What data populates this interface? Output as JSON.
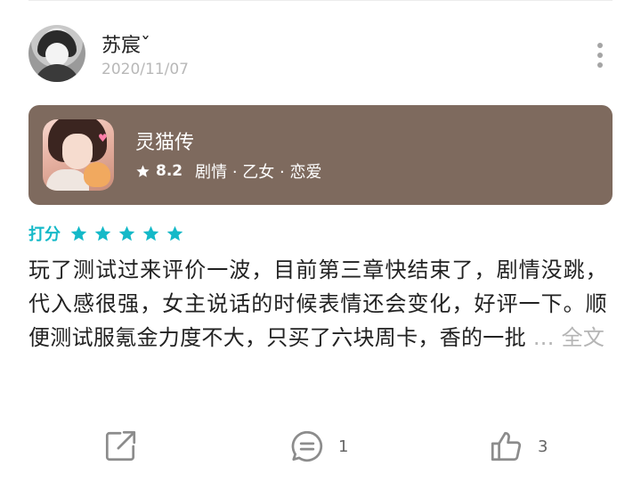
{
  "review": {
    "author": {
      "name": "苏宸ˇ",
      "date": "2020/11/07"
    },
    "game": {
      "title": "灵猫传",
      "rating": "8.2",
      "tags": "剧情 · 乙女 · 恋爱"
    },
    "score": {
      "label": "打分",
      "stars": 5,
      "max_stars": 5,
      "star_color": "#14b9c8"
    },
    "body": {
      "text": "玩了测试过来评价一波，目前第三章快结束了，剧情没跳，代入感很强，女主说话的时候表情还会变化，好评一下。顺便测试服氪金力度不大，只买了六块周卡，香的一批",
      "ellipsis": "...",
      "more_label": "全文"
    },
    "actions": {
      "share": {
        "icon": "share-icon"
      },
      "comment": {
        "icon": "comment-icon",
        "count": "1"
      },
      "like": {
        "icon": "thumbs-up-icon",
        "count": "3"
      }
    },
    "colors": {
      "card_background": "#7e6a5e",
      "accent": "#14b9c8",
      "muted_text": "#b5b5b5"
    }
  }
}
